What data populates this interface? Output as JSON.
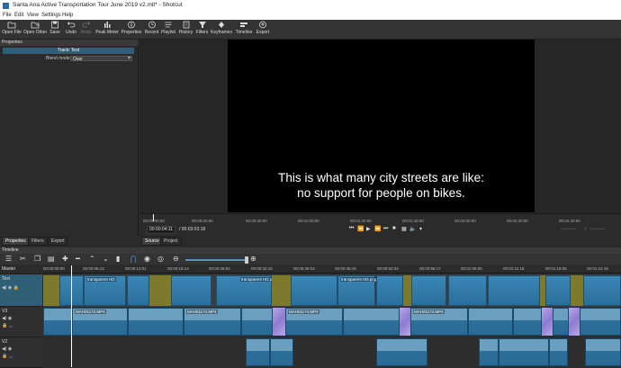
{
  "window": {
    "title": "Santa Ana Active Transportation Tour June 2019 v2.mlt* - Shotcut"
  },
  "menu": [
    "File",
    "Edit",
    "View",
    "Settings",
    "Help"
  ],
  "toolbar": [
    {
      "label": "Open File",
      "icon": "folder-icon"
    },
    {
      "label": "Open Other",
      "icon": "open-other-icon"
    },
    {
      "label": "Save",
      "icon": "save-icon"
    },
    {
      "label": "Undo",
      "icon": "undo-icon"
    },
    {
      "label": "Redo",
      "icon": "redo-icon"
    },
    {
      "label": "Peak Meter",
      "icon": "peak-meter-icon"
    },
    {
      "label": "Properties",
      "icon": "properties-icon"
    },
    {
      "label": "Recent",
      "icon": "recent-icon"
    },
    {
      "label": "Playlist",
      "icon": "playlist-icon"
    },
    {
      "label": "History",
      "icon": "history-icon"
    },
    {
      "label": "Filters",
      "icon": "filters-icon"
    },
    {
      "label": "Keyframes",
      "icon": "keyframes-icon"
    },
    {
      "label": "Timeline",
      "icon": "timeline-icon"
    },
    {
      "label": "Export",
      "icon": "export-icon"
    }
  ],
  "properties": {
    "header": "Properties",
    "track_title": "Track: Text",
    "blend_label": "Blend mode",
    "blend_value": "Over"
  },
  "left_tabs": [
    "Properties",
    "Filters",
    "Export"
  ],
  "player": {
    "subtitle": "This is what many city streets are like:\nno support for people on bikes.",
    "ruler_ticks": [
      "00:00:00:00",
      "00:00:20:00",
      "00:00:40:00",
      "00:01:00:00",
      "00:01:20:00",
      "00:01:40:00",
      "00:02:00:00",
      "00:02:20:00",
      "00:02:40:00"
    ],
    "current_time": "00:00:04:11",
    "total_time": "/ 00:03:03:18",
    "in_point": "--:--:--:--",
    "out_point": "--:--:--:--",
    "tabs": [
      "Source",
      "Project"
    ]
  },
  "timeline": {
    "header": "Timeline",
    "ruler_ticks": [
      "00:00:00:00",
      "00:00:06:13",
      "00:00:13:01",
      "00:00:19:14",
      "00:00:26:02",
      "00:00:32:15",
      "00:00:39:03",
      "00:00:45:16",
      "00:00:52:04",
      "00:00:58:17",
      "00:01:05:05",
      "00:01:11:18",
      "00:01:18:06",
      "00:01:24:19"
    ],
    "tracks": [
      {
        "name": "Master"
      },
      {
        "name": "Text"
      },
      {
        "name": "V3"
      },
      {
        "name": "V2"
      }
    ],
    "text_clip_labels": [
      "transparent HD",
      "transparent HD.png",
      "transparent HD.png"
    ],
    "v3_clip_labels": [
      "MAH01174.MP4",
      "MAH01174.MP4",
      "MAH01174.MP4",
      "MAH01174.MP4"
    ]
  },
  "colors": {
    "accent": "#2e5f77",
    "clip": "#3b86b5",
    "gap": "#7d7a2e",
    "transition": "#b9a7e6"
  }
}
